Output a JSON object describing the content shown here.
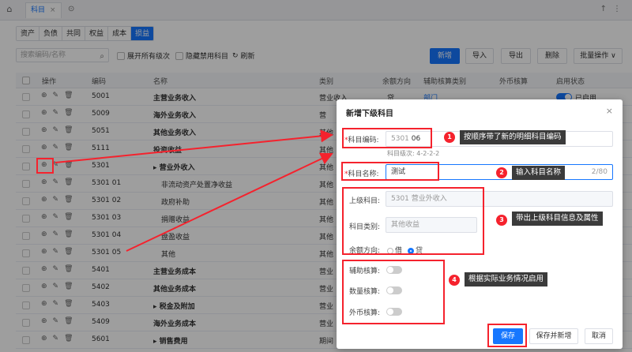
{
  "topbar": {
    "tab_label": "科目",
    "tab_close": "×"
  },
  "categories": [
    {
      "label": "资产",
      "active": false
    },
    {
      "label": "负债",
      "active": false
    },
    {
      "label": "共同",
      "active": false
    },
    {
      "label": "权益",
      "active": false
    },
    {
      "label": "成本",
      "active": false
    },
    {
      "label": "损益",
      "active": true
    }
  ],
  "toolbar": {
    "search_placeholder": "搜索编码/名称",
    "expand_all_label": "展开所有级次",
    "hide_disabled_label": "隐藏禁用科目",
    "refresh_label": "刷新",
    "new_label": "新增",
    "import_label": "导入",
    "export_label": "导出",
    "delete_label": "删除",
    "batch_label": "批量操作"
  },
  "table": {
    "headers": [
      "操作",
      "编码",
      "名称",
      "类别",
      "余额方向",
      "辅助核算类别",
      "外币核算",
      "启用状态"
    ],
    "rows": [
      {
        "code": "5001",
        "name": "主营业务收入",
        "bold": true,
        "type": "营业收入",
        "dir": "贷",
        "aux": "部门",
        "status": "已启用"
      },
      {
        "code": "5009",
        "name": "海外业务收入",
        "bold": true,
        "type": "营",
        "dir": "",
        "aux": "",
        "status": ""
      },
      {
        "code": "5051",
        "name": "其他业务收入",
        "bold": true,
        "type": "其他",
        "dir": "",
        "aux": "",
        "status": ""
      },
      {
        "code": "5111",
        "name": "投资收益",
        "bold": true,
        "type": "其他",
        "dir": "",
        "aux": "",
        "status": ""
      },
      {
        "code": "5301",
        "name": "营业外收入",
        "bold": true,
        "type": "其他",
        "dir": "",
        "aux": "",
        "status": ""
      },
      {
        "code": "5301 01",
        "name": "非流动资产处置净收益",
        "bold": false,
        "type": "其他",
        "dir": "",
        "aux": "",
        "status": ""
      },
      {
        "code": "5301 02",
        "name": "政府补助",
        "bold": false,
        "type": "其他",
        "dir": "",
        "aux": "",
        "status": ""
      },
      {
        "code": "5301 03",
        "name": "捐赠收益",
        "bold": false,
        "type": "其他",
        "dir": "",
        "aux": "",
        "status": ""
      },
      {
        "code": "5301 04",
        "name": "盘盈收益",
        "bold": false,
        "type": "其他",
        "dir": "",
        "aux": "",
        "status": ""
      },
      {
        "code": "5301 05",
        "name": "其他",
        "bold": false,
        "type": "其他",
        "dir": "",
        "aux": "",
        "status": ""
      },
      {
        "code": "5401",
        "name": "主营业务成本",
        "bold": true,
        "type": "营业",
        "dir": "",
        "aux": "",
        "status": ""
      },
      {
        "code": "5402",
        "name": "其他业务成本",
        "bold": true,
        "type": "营业",
        "dir": "",
        "aux": "",
        "status": ""
      },
      {
        "code": "5403",
        "name": "税金及附加",
        "bold": true,
        "type": "营业",
        "dir": "",
        "aux": "",
        "status": ""
      },
      {
        "code": "5409",
        "name": "海外业务成本",
        "bold": true,
        "type": "营业",
        "dir": "",
        "aux": "",
        "status": ""
      },
      {
        "code": "5601",
        "name": "销售费用",
        "bold": true,
        "type": "期间",
        "dir": "",
        "aux": "",
        "status": ""
      }
    ]
  },
  "dialog": {
    "title": "新增下级科目",
    "close": "×",
    "code_label": "科目编码:",
    "code_prefix": "5301",
    "code_suffix": "06",
    "level_hint": "科目级次: 4-2-2-2",
    "name_label": "科目名称:",
    "name_value": "测试",
    "name_count": "2/80",
    "parent_label": "上级科目:",
    "parent_value": "5301 营业外收入",
    "type_label": "科目类别:",
    "type_value": "其他收益",
    "dir_label": "余额方向:",
    "dir_debit": "借",
    "dir_credit": "贷",
    "aux_label": "辅助核算:",
    "qty_label": "数量核算:",
    "fx_label": "外币核算:",
    "save_label": "保存",
    "save_new_label": "保存并新增",
    "cancel_label": "取消"
  },
  "annotations": [
    {
      "num": "1",
      "text": "按顺序带了新的明细科目编码"
    },
    {
      "num": "2",
      "text": "输入科目名称"
    },
    {
      "num": "3",
      "text": "带出上级科目信息及属性"
    },
    {
      "num": "4",
      "text": "根据实际业务情况启用"
    }
  ],
  "colors": {
    "primary": "#1677ff",
    "annotation_red": "#f5222d"
  }
}
